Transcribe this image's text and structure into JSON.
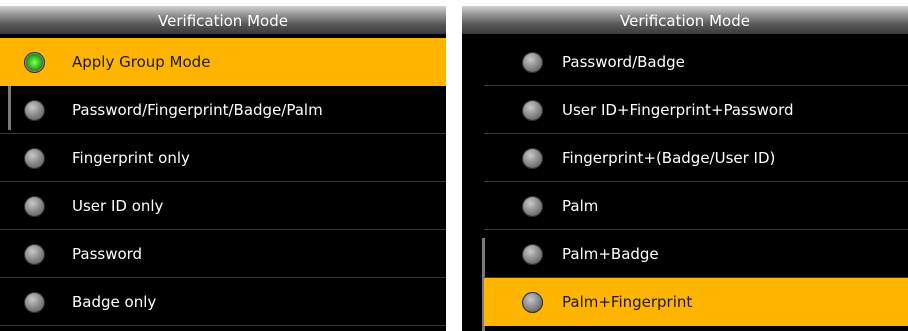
{
  "left_screen": {
    "title": "Verification Mode",
    "items": [
      {
        "label": "Apply Group Mode",
        "selected": true,
        "checked": true
      },
      {
        "label": "Password/Fingerprint/Badge/Palm",
        "selected": false,
        "checked": false
      },
      {
        "label": "Fingerprint only",
        "selected": false,
        "checked": false
      },
      {
        "label": "User ID only",
        "selected": false,
        "checked": false
      },
      {
        "label": "Password",
        "selected": false,
        "checked": false
      },
      {
        "label": "Badge only",
        "selected": false,
        "checked": false
      }
    ]
  },
  "right_screen": {
    "title": "Verification Mode",
    "items": [
      {
        "label": "Password/Badge",
        "selected": false,
        "checked": false
      },
      {
        "label": "User ID+Fingerprint+Password",
        "selected": false,
        "checked": false
      },
      {
        "label": "Fingerprint+(Badge/User ID)",
        "selected": false,
        "checked": false
      },
      {
        "label": "Palm",
        "selected": false,
        "checked": false
      },
      {
        "label": "Palm+Badge",
        "selected": false,
        "checked": false
      },
      {
        "label": "Palm+Fingerprint",
        "selected": true,
        "checked": false
      }
    ]
  },
  "colors": {
    "highlight": "#ffb400",
    "background": "#000000",
    "radio_on": "#3fc21f"
  }
}
